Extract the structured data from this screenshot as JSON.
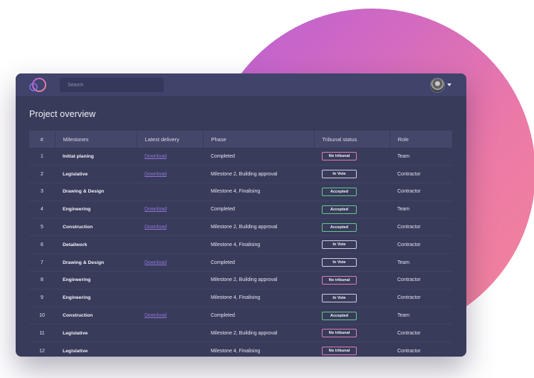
{
  "colors": {
    "window_bg": "#383b5a",
    "topbar_bg": "#40436a",
    "header_row_bg": "#444769",
    "accent_gradient_start": "#b85fd6",
    "accent_gradient_end": "#f2849a",
    "link": "#8e76d8",
    "status_no_tribunal": "#e07fb2",
    "status_accepted": "#66c98c",
    "status_in_vote": "#cfd1e3"
  },
  "topbar": {
    "logo_icon": "circle-ring-logo-icon",
    "search_placeholder": "Search",
    "avatar_icon": "user-avatar-icon",
    "caret_icon": "chevron-down-icon"
  },
  "page": {
    "title": "Project overview"
  },
  "table": {
    "columns": [
      "#",
      "Milestones",
      "Latest delivery",
      "Phase",
      "Tribunal status",
      "Role"
    ],
    "rows": [
      {
        "num": "1",
        "milestone": "Initial planing",
        "delivery": "Download",
        "phase": "Completed",
        "status": "No tribunal",
        "status_kind": "pink",
        "role": "Team"
      },
      {
        "num": "2",
        "milestone": "Legislative",
        "delivery": "Download",
        "phase": "Milestone 2, Building approval",
        "status": "In Vote",
        "status_kind": "white",
        "role": "Contractor"
      },
      {
        "num": "3",
        "milestone": "Drawing & Design",
        "delivery": "",
        "phase": "Milestone 4, Finalising",
        "status": "Accepted",
        "status_kind": "green",
        "role": "Contractor"
      },
      {
        "num": "4",
        "milestone": "Engineering",
        "delivery": "Download",
        "phase": "Completed",
        "status": "Accepted",
        "status_kind": "green",
        "role": "Team"
      },
      {
        "num": "5",
        "milestone": "Construction",
        "delivery": "Download",
        "phase": "Milestone 2, Building approval",
        "status": "Accepted",
        "status_kind": "green",
        "role": "Contractor"
      },
      {
        "num": "6",
        "milestone": "Detailwork",
        "delivery": "",
        "phase": "Milestone 4, Finalising",
        "status": "In Vote",
        "status_kind": "white",
        "role": "Contractor"
      },
      {
        "num": "7",
        "milestone": "Drawing & Design",
        "delivery": "Download",
        "phase": "Completed",
        "status": "In Vote",
        "status_kind": "white",
        "role": "Team"
      },
      {
        "num": "8",
        "milestone": "Engineering",
        "delivery": "",
        "phase": "Milestone 2, Building approval",
        "status": "No tribunal",
        "status_kind": "pink",
        "role": "Contractor"
      },
      {
        "num": "9",
        "milestone": "Engineering",
        "delivery": "",
        "phase": "Milestone 4, Finalising",
        "status": "In Vote",
        "status_kind": "white",
        "role": "Contractor"
      },
      {
        "num": "10",
        "milestone": "Construction",
        "delivery": "Download",
        "phase": "Completed",
        "status": "Accepted",
        "status_kind": "green",
        "role": "Team"
      },
      {
        "num": "11",
        "milestone": "Legislative",
        "delivery": "",
        "phase": "Milestone 2, Building approval",
        "status": "No tribunal",
        "status_kind": "pink",
        "role": "Contractor"
      },
      {
        "num": "12",
        "milestone": "Legislative",
        "delivery": "",
        "phase": "Milestone 4, Finalising",
        "status": "No tribunal",
        "status_kind": "pink",
        "role": "Contractor"
      }
    ]
  }
}
